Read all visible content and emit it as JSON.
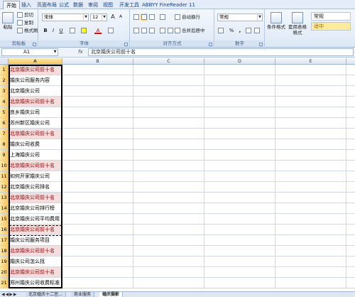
{
  "tabs": [
    "开始",
    "插入",
    "页面布局",
    "公式",
    "数据",
    "审阅",
    "视图",
    "开发工具",
    "ABBYY FineReader 11"
  ],
  "ribbon": {
    "clipboard": {
      "paste": "粘贴",
      "cut": "剪切",
      "copy": "复制",
      "format_painter": "格式刷",
      "label": "剪贴板"
    },
    "font": {
      "name": "宋体",
      "size": "12",
      "bold": "B",
      "italic": "I",
      "underline": "U",
      "grow": "A",
      "shrink": "A",
      "font_color": "A",
      "label": "字体"
    },
    "alignment": {
      "wrap": "自动换行",
      "merge": "合并后居中",
      "label": "对齐方式"
    },
    "number": {
      "format": "常规",
      "percent": "%",
      "comma": ",",
      "label": "数字"
    },
    "styles": {
      "conditional": "条件格式",
      "table": "套用表格格式",
      "normal": "常规",
      "neutral": "适中"
    }
  },
  "formula_bar": {
    "cell_ref": "A1",
    "fx": "fx",
    "value": "北京婚庆公司前十名"
  },
  "columns": [
    "A",
    "B",
    "C",
    "D",
    "E",
    "F"
  ],
  "rows": [
    {
      "n": "1",
      "a": "北京婚庆公司前十名",
      "shade": true
    },
    {
      "n": "2",
      "a": "婚庆公司服务内容",
      "shade": false
    },
    {
      "n": "3",
      "a": "北京婚庆公司",
      "shade": false
    },
    {
      "n": "4",
      "a": "北京婚庆公司前十名",
      "shade": true
    },
    {
      "n": "5",
      "a": "良乡婚庆公司",
      "shade": false
    },
    {
      "n": "6",
      "a": "苏州新区婚庆公司",
      "shade": false
    },
    {
      "n": "7",
      "a": "北京婚庆公司前十名",
      "shade": true
    },
    {
      "n": "8",
      "a": "婚庆公司收费",
      "shade": false
    },
    {
      "n": "9",
      "a": "上海婚庆公司",
      "shade": false
    },
    {
      "n": "10",
      "a": "北京婚庆公司前十名",
      "shade": true
    },
    {
      "n": "11",
      "a": "如何开家婚庆公司",
      "shade": false
    },
    {
      "n": "12",
      "a": "北京婚庆公司排名",
      "shade": false
    },
    {
      "n": "13",
      "a": "北京婚庆公司前十名",
      "shade": true
    },
    {
      "n": "14",
      "a": "北京婚庆公司排行榜",
      "shade": false
    },
    {
      "n": "15",
      "a": "北京婚庆公司平均费用",
      "shade": false
    },
    {
      "n": "16",
      "a": "北京婚庆公司前十名",
      "shade": true
    },
    {
      "n": "17",
      "a": "婚庆公司服务项目",
      "shade": false
    },
    {
      "n": "18",
      "a": "北京婚庆公司前十名",
      "shade": true
    },
    {
      "n": "19",
      "a": "婚庆公司怎么找",
      "shade": false
    },
    {
      "n": "20",
      "a": "北京婚庆公司前十名",
      "shade": true
    },
    {
      "n": "21",
      "a": "郑州婚庆公司收费标准",
      "shade": false
    }
  ],
  "sheet_tabs": [
    "北京婚庆十二宫...",
    "商业服务",
    "婚庆摄影"
  ],
  "active_sheet": 2
}
